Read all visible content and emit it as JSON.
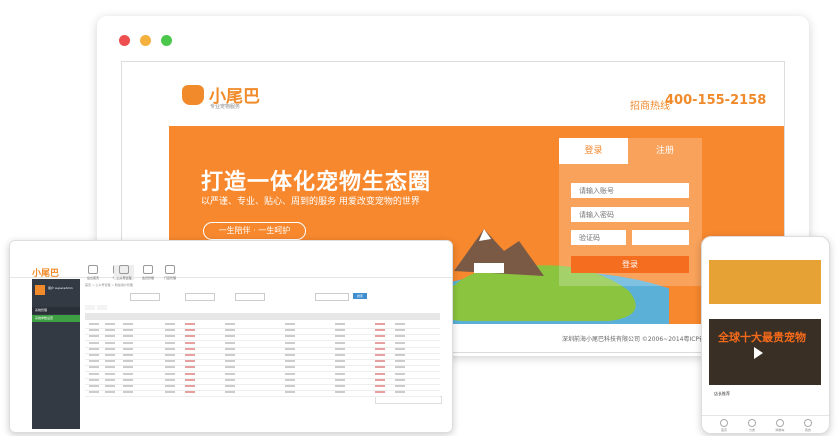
{
  "desktop": {
    "logo_text": "小尾巴",
    "logo_sub": "专业宠物服务",
    "hotline_label": "招商热线",
    "hotline_number": "400-155-2158",
    "hero_title": "打造一体化宠物生态圈",
    "hero_subtitle": "以严谨、专业、贴心、周到的服务 用爱改变宠物的世界",
    "slogan": "一生陪伴 · 一生呵护",
    "login": {
      "tab_login": "登录",
      "tab_register": "注册",
      "account_placeholder": "请输入账号",
      "password_placeholder": "请输入密码",
      "code_placeholder": "验证码",
      "submit": "登录"
    },
    "copyright": "深圳前海小尾巴科技有限公司    ©2006~2014粤ICP备0"
  },
  "admin": {
    "logo_text": "小尾巴",
    "nav": [
      "后台首页",
      "个人资料",
      "公众号管理",
      "会员管理",
      "门店管理"
    ],
    "user": "用户 superadmin",
    "side_items": [
      "系统管理",
      "系统参数设置"
    ],
    "breadcrumb": "首页 > 公众号管理 > 粉丝用户管理",
    "search_label": "搜索"
  },
  "phone": {
    "promo": "全球十大最贵宠物",
    "section": "店长推荐",
    "tabs": [
      "首页",
      "分类",
      "购物车",
      "我的"
    ]
  },
  "colors": {
    "brand": "#f7882e",
    "button": "#f56d1e",
    "sidebar": "#343a44"
  }
}
